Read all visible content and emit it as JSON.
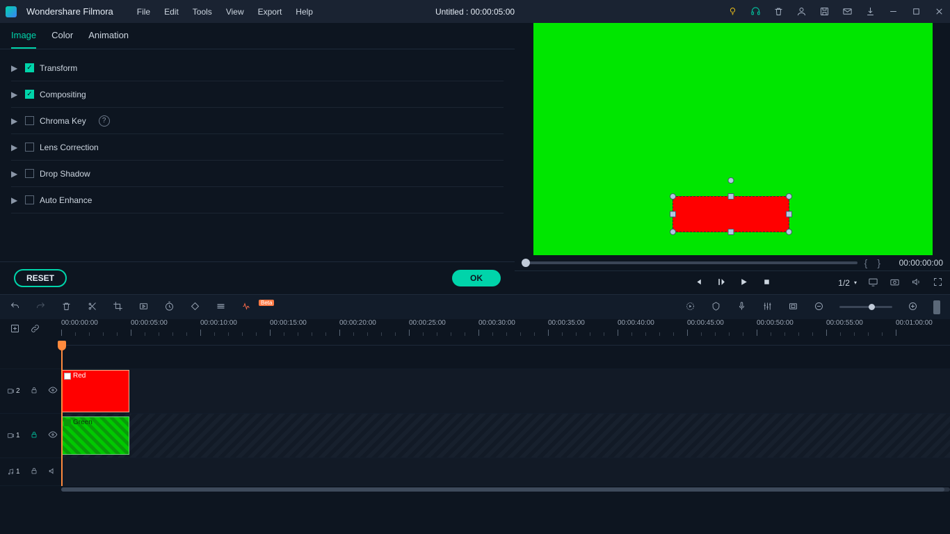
{
  "titlebar": {
    "app_name": "Wondershare Filmora",
    "menus": [
      "File",
      "Edit",
      "Tools",
      "View",
      "Export",
      "Help"
    ],
    "project": "Untitled : 00:00:05:00"
  },
  "panel": {
    "tabs": [
      "Image",
      "Color",
      "Animation"
    ],
    "active_tab": "Image",
    "props": [
      {
        "label": "Transform",
        "checked": true,
        "help": false
      },
      {
        "label": "Compositing",
        "checked": true,
        "help": false
      },
      {
        "label": "Chroma Key",
        "checked": false,
        "help": true
      },
      {
        "label": "Lens Correction",
        "checked": false,
        "help": false
      },
      {
        "label": "Drop Shadow",
        "checked": false,
        "help": false
      },
      {
        "label": "Auto Enhance",
        "checked": false,
        "help": false
      }
    ],
    "reset": "RESET",
    "ok": "OK"
  },
  "preview": {
    "timecode": "00:00:00:00",
    "zoom": "1/2"
  },
  "toolbar": {
    "beta": "Beta"
  },
  "ruler": {
    "marks": [
      "00:00:00:00",
      "00:00:05:00",
      "00:00:10:00",
      "00:00:15:00",
      "00:00:20:00",
      "00:00:25:00",
      "00:00:30:00",
      "00:00:35:00",
      "00:00:40:00",
      "00:00:45:00",
      "00:00:50:00",
      "00:00:55:00",
      "00:01:00:00"
    ]
  },
  "tracks": {
    "v2": "2",
    "v1": "1",
    "a1": "1",
    "clip_red": "Red",
    "clip_green": "Green"
  }
}
